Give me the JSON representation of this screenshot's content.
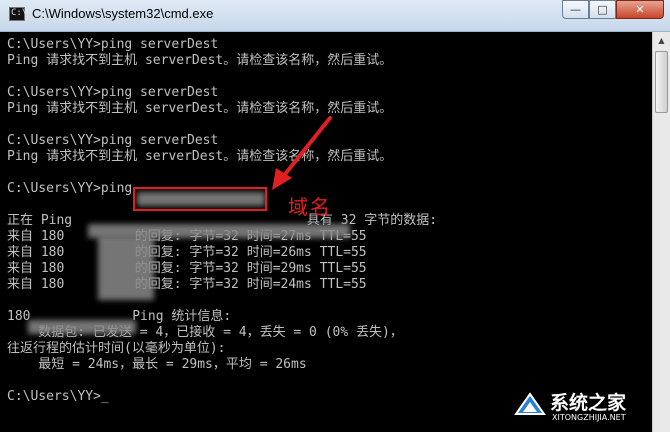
{
  "window": {
    "title": "C:\\Windows\\system32\\cmd.exe",
    "icon": "cmd-icon",
    "minimize_label": "—",
    "maximize_label": "□",
    "close_label": "✕"
  },
  "console": {
    "lines": [
      "C:\\Users\\YY>ping serverDest",
      "Ping 请求找不到主机 serverDest。请检查该名称，然后重试。",
      "",
      "C:\\Users\\YY>ping serverDest",
      "Ping 请求找不到主机 serverDest。请检查该名称，然后重试。",
      "",
      "C:\\Users\\YY>ping serverDest",
      "Ping 请求找不到主机 serverDest。请检查该名称，然后重试。",
      "",
      "C:\\Users\\YY>ping",
      "",
      "正在 Ping                              具有 32 字节的数据:",
      "来自 180         的回复: 字节=32 时间=27ms TTL=55",
      "来自 180         的回复: 字节=32 时间=26ms TTL=55",
      "来自 180         的回复: 字节=32 时间=29ms TTL=55",
      "来自 180         的回复: 字节=32 时间=24ms TTL=55",
      "",
      "180             Ping 统计信息:",
      "    数据包: 已发送 = 4，已接收 = 4，丢失 = 0 (0% 丢失)，",
      "往返行程的估计时间(以毫秒为单位):",
      "    最短 = 24ms，最长 = 29ms，平均 = 26ms",
      "",
      "C:\\Users\\YY>_"
    ]
  },
  "annotation": {
    "label": "域名",
    "color": "#e02020"
  },
  "watermark": {
    "title": "系统之家",
    "subtitle": "XITONGZHIJIA.NET"
  },
  "colors": {
    "console_bg": "#000000",
    "console_text": "#c0c0c0",
    "close_button": "#c7452a"
  }
}
